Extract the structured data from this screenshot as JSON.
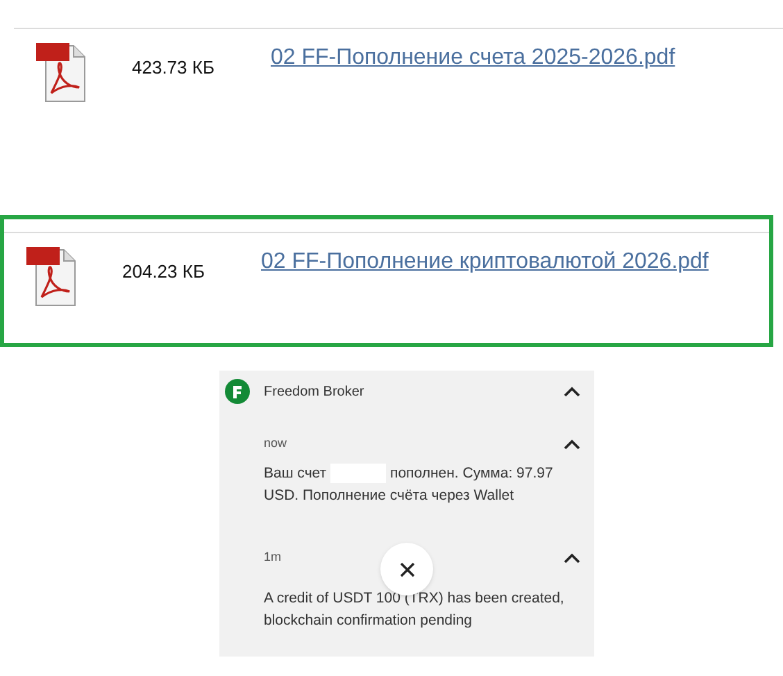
{
  "files": [
    {
      "size": "423.73 КБ",
      "name": "02 FF-Пополнение счета 2025-2026.pdf",
      "highlighted": false
    },
    {
      "size": "204.23 КБ",
      "name": "02 FF-Пополнение криптовалютой 2026.pdf",
      "highlighted": true
    }
  ],
  "notification": {
    "app": "Freedom Broker",
    "expanded": true,
    "items": [
      {
        "time": "now",
        "expanded": true,
        "parts": [
          {
            "kind": "text",
            "text": "Ваш счет"
          },
          {
            "kind": "redacted"
          },
          {
            "kind": "text",
            "text": "пополнен. Сумма: 97.97 USD. Пополнение счёта через Wallet"
          }
        ]
      },
      {
        "time": "1m",
        "expanded": true,
        "parts": [
          {
            "kind": "text",
            "text": "A credit of USDT 100 (TRX) has been created, blockchain confirmation pending"
          }
        ]
      }
    ],
    "close_button": true
  }
}
